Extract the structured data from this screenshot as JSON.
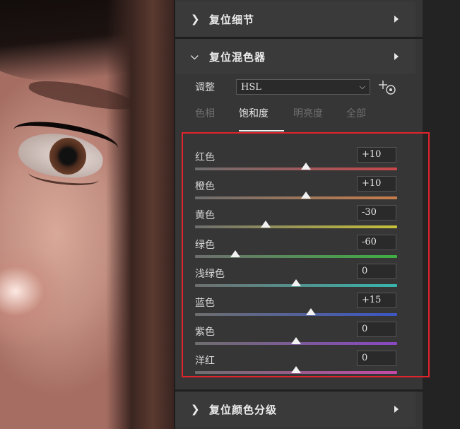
{
  "sections": {
    "reset_detail": "复位细节",
    "reset_mixer": "复位混色器",
    "reset_color_grading": "复位颜色分级"
  },
  "adjust": {
    "label": "调整",
    "selected": "HSL"
  },
  "tabs": [
    "色相",
    "饱和度",
    "明亮度",
    "全部"
  ],
  "active_tab": "饱和度",
  "sliders": [
    {
      "label": "红色",
      "value": "+10",
      "level": 10,
      "color": "#c9474b"
    },
    {
      "label": "橙色",
      "value": "+10",
      "level": 10,
      "color": "#c97d4a"
    },
    {
      "label": "黄色",
      "value": "-30",
      "level": -30,
      "color": "#c7c23a"
    },
    {
      "label": "绿色",
      "value": "-60",
      "level": -60,
      "color": "#3fae44"
    },
    {
      "label": "浅绿色",
      "value": "0",
      "level": 0,
      "color": "#37b5ad"
    },
    {
      "label": "蓝色",
      "value": "+15",
      "level": 15,
      "color": "#3b56c4"
    },
    {
      "label": "紫色",
      "value": "0",
      "level": 0,
      "color": "#8a48c2"
    },
    {
      "label": "洋红",
      "value": "0",
      "level": 0,
      "color": "#c54aa8"
    }
  ],
  "highlight_color": "#e0242b"
}
